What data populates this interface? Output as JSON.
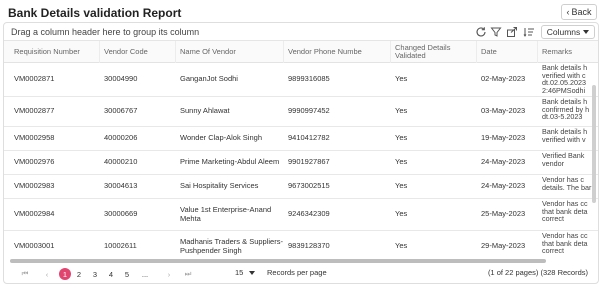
{
  "page": {
    "title": "Bank Details validation Report",
    "back_label": "Back"
  },
  "toolbar": {
    "group_hint": "Drag a column header here to group its column",
    "columns_label": "Columns",
    "icons": [
      "refresh-icon",
      "filter-icon",
      "export-icon",
      "sort-list-icon"
    ]
  },
  "grid": {
    "columns": [
      "Requisition Number",
      "Vendor Code",
      "Name Of Vendor",
      "Vendor Phone Numbe",
      "Changed Details Validated",
      "Date",
      "Remarks"
    ],
    "rows": [
      {
        "req": "VM0002871",
        "code": "30004990",
        "name": "GanganJot Sodhi",
        "phone": "9899316085",
        "validated": "Yes",
        "date": "02-May-2023",
        "remarks": "Bank details h verified with c dt.02.05.2023 2:46PMSodhi"
      },
      {
        "req": "VM0002877",
        "code": "30006767",
        "name": "Sunny Ahlawat",
        "phone": "9990997452",
        "validated": "Yes",
        "date": "03-May-2023",
        "remarks": "Bank details h confirmed by h dt.03-5.2023"
      },
      {
        "req": "VM0002958",
        "code": "40000206",
        "name": "Wonder Clap-Alok Singh",
        "phone": "9410412782",
        "validated": "Yes",
        "date": "19-May-2023",
        "remarks": "Bank details h verified with v"
      },
      {
        "req": "VM0002976",
        "code": "40000210",
        "name": "Prime Marketing-Abdul Aleem",
        "phone": "9901927867",
        "validated": "Yes",
        "date": "24-May-2023",
        "remarks": "Verified Bank vendor"
      },
      {
        "req": "VM0002983",
        "code": "30004613",
        "name": "Sai Hospitality Services",
        "phone": "9673002515",
        "validated": "Yes",
        "date": "24-May-2023",
        "remarks": "Vendor has c details. The bar"
      },
      {
        "req": "VM0002984",
        "code": "30000669",
        "name": "Value 1st Enterprise-Anand Mehta",
        "phone": "9246342309",
        "validated": "Yes",
        "date": "25-May-2023",
        "remarks": "Vendor has cc that bank deta correct"
      },
      {
        "req": "VM0003001",
        "code": "10002611",
        "name": "Madhanis Traders & Suppliers-Pushpender Singh",
        "phone": "9839128370",
        "validated": "Yes",
        "date": "29-May-2023",
        "remarks": "Vendor has cc that bank deta correct"
      }
    ]
  },
  "pagination": {
    "first": "⏮",
    "prev": "‹",
    "pages": [
      "1",
      "2",
      "3",
      "4",
      "5",
      "..."
    ],
    "next": "›",
    "last": "⏭",
    "records_per_page": "15",
    "records_per_page_label": "Records per page",
    "summary": "(1 of 22 pages) (328 Records)"
  },
  "colors": {
    "accent": "#e0456f"
  }
}
